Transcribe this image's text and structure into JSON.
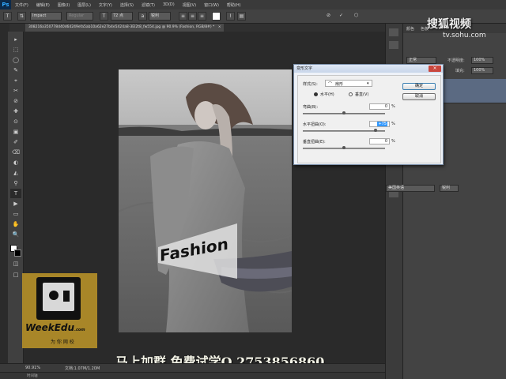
{
  "menubar": {
    "logo": "Ps",
    "items": [
      "文件(F)",
      "编辑(E)",
      "图像(I)",
      "图层(L)",
      "文字(Y)",
      "选择(S)",
      "滤镜(T)",
      "3D(D)",
      "视图(V)",
      "窗口(W)",
      "帮助(H)"
    ]
  },
  "options": {
    "font": "Impact",
    "style": "Regular",
    "size": "72 点",
    "aa": "锐利"
  },
  "doc_tab": {
    "title": "308216a350778d40d64249efa5ab10a62e27b4e5424a8-3EI2t8_fw554.jpg @ 90.9% (Fashion, RGB/8#) *",
    "close": "×"
  },
  "tools": [
    "▸",
    "⬚",
    "◯",
    "✎",
    "⌖",
    "✂",
    "⊘",
    "✚",
    "⊙",
    "▣",
    "✐",
    "⌫",
    "◐",
    "◭",
    "⚲",
    "⬠",
    "T",
    "▶",
    "▭",
    "✋",
    "🔍",
    "…",
    "■",
    "□",
    "◫"
  ],
  "canvas": {
    "fashion_text": "Fashion",
    "watermark_caption": "马上加群 免费试学Q 2753856860"
  },
  "logo": {
    "name": "WeekEdu",
    "suffix": ".com",
    "tagline": "为 你 网 校"
  },
  "site_watermark": {
    "name": "搜狐视频",
    "url": "tv.sohu.com"
  },
  "status": {
    "zoom": "90.91%",
    "doc": "文档:1.07M/1.20M",
    "timeline": "时间轴"
  },
  "right_panel": {
    "tab1": "颜色",
    "tab2": "色板",
    "layer_mode": "正常",
    "opacity_label": "不透明度:",
    "opacity": "100%",
    "fill_label": "填充:",
    "fill": "100%",
    "font_lang": "美国英语",
    "aa2": "锐利"
  },
  "dialog": {
    "title": "变形文字",
    "close": "×",
    "style_label": "样式(S):",
    "style_value": "扇形",
    "orient_h": "水平(H)",
    "orient_v": "垂直(V)",
    "bend_label": "弯曲(B):",
    "bend_value": "0",
    "hdist_label": "水平扭曲(O):",
    "hdist_value": "+75",
    "vdist_label": "垂直扭曲(E):",
    "vdist_value": "0",
    "percent": "%",
    "ok": "确定",
    "cancel": "取消"
  },
  "colors": {
    "accent": "#31a8ff",
    "dialog_bg": "#f0f0f0",
    "highlight": "#3399ff"
  }
}
